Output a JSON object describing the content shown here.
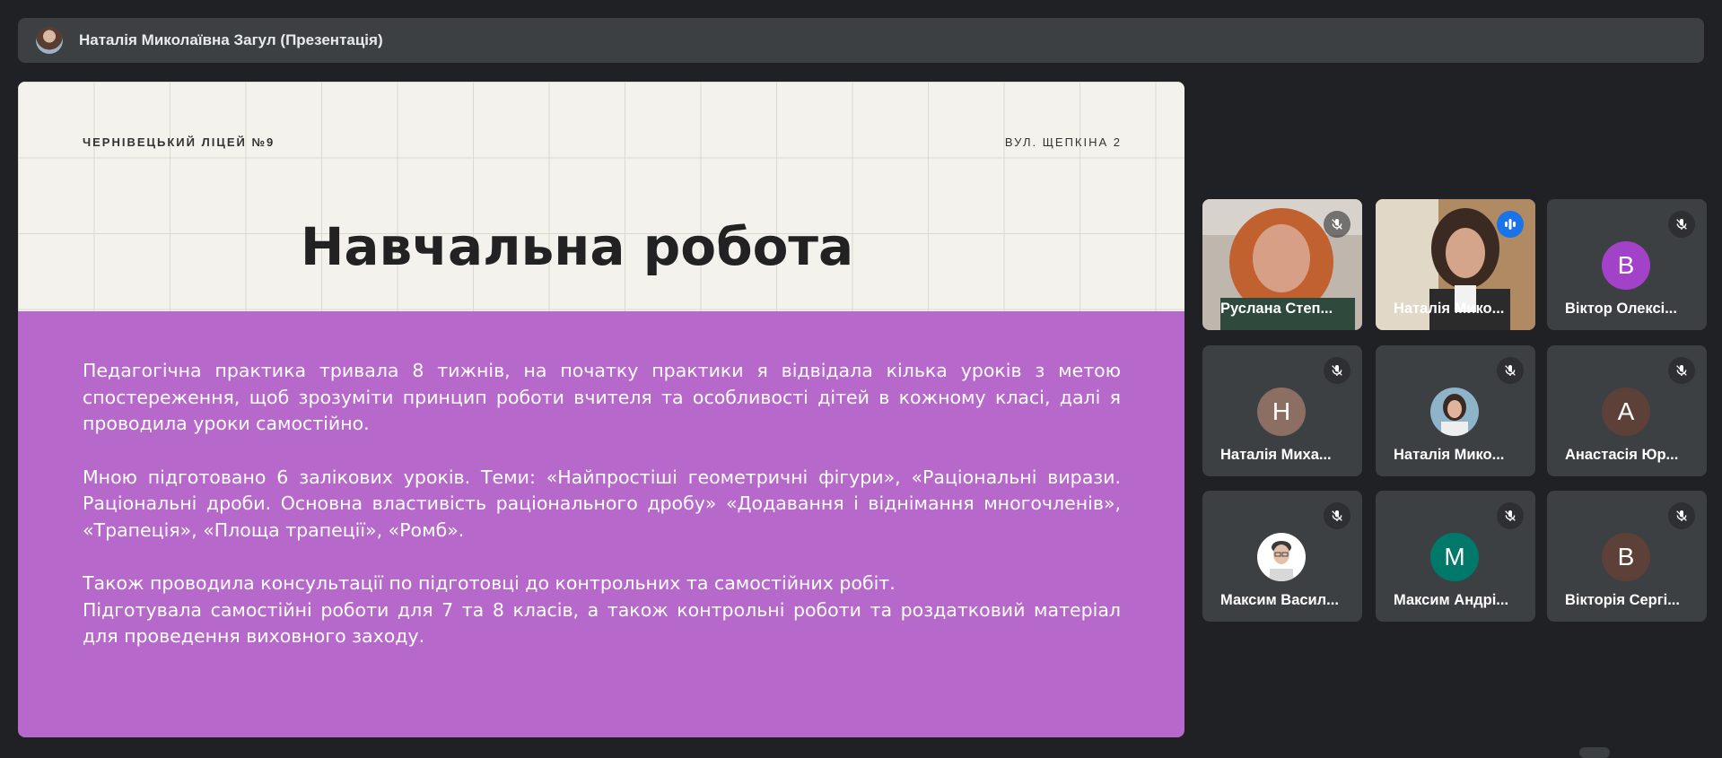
{
  "presenter": {
    "label": "Наталія Миколаївна Загул (Презентація)"
  },
  "slide": {
    "school": "ЧЕРНІВЕЦЬКИЙ ЛІЦЕЙ №9",
    "address": "ВУЛ. ЩЕПКІНА 2",
    "title": "Навчальна робота",
    "paragraphs": [
      "Педагогічна практика тривала 8 тижнів, на початку практики я відвідала кілька уроків з метою спостереження, щоб зрозуміти принцип роботи вчителя та особливості дітей в кожному класі, далі я проводила уроки самостійно.",
      "Мною підготовано 6 залікових уроків.  Теми: «Найпростіші геометричні фігури», «Раціональні вирази. Раціональні дроби. Основна властивість раціонального дробу» «Додавання і віднімання многочленів», «Трапеція», «Площа трапеції», «Ромб».",
      "Також проводила консультації по підготовці до контрольних та самостійних робіт.",
      "Підготувала самостійні роботи для 7 та 8 класів, а також контрольні роботи та роздатковий матеріал для проведення виховного заходу."
    ]
  },
  "participants": [
    {
      "name": "Руслана Степ...",
      "type": "video",
      "mic": "muted"
    },
    {
      "name": "Наталія Мико...",
      "type": "video",
      "mic": "speaking"
    },
    {
      "name": "Віктор Олексі...",
      "type": "letter",
      "letter": "В",
      "color": "#a142c9",
      "mic": "muted"
    },
    {
      "name": "Наталія Миха...",
      "type": "letter",
      "letter": "Н",
      "color": "#8d6e63",
      "mic": "muted"
    },
    {
      "name": "Наталія Мико...",
      "type": "photo",
      "mic": "muted"
    },
    {
      "name": "Анастасія Юр...",
      "type": "letter",
      "letter": "А",
      "color": "#5d4037",
      "mic": "muted"
    },
    {
      "name": "Максим Васил...",
      "type": "photo",
      "mic": "muted"
    },
    {
      "name": "Максим Андрі...",
      "type": "letter",
      "letter": "М",
      "color": "#00796b",
      "mic": "muted"
    },
    {
      "name": "Вікторія Сергі...",
      "type": "letter",
      "letter": "В",
      "color": "#5d4037",
      "mic": "muted"
    }
  ]
}
